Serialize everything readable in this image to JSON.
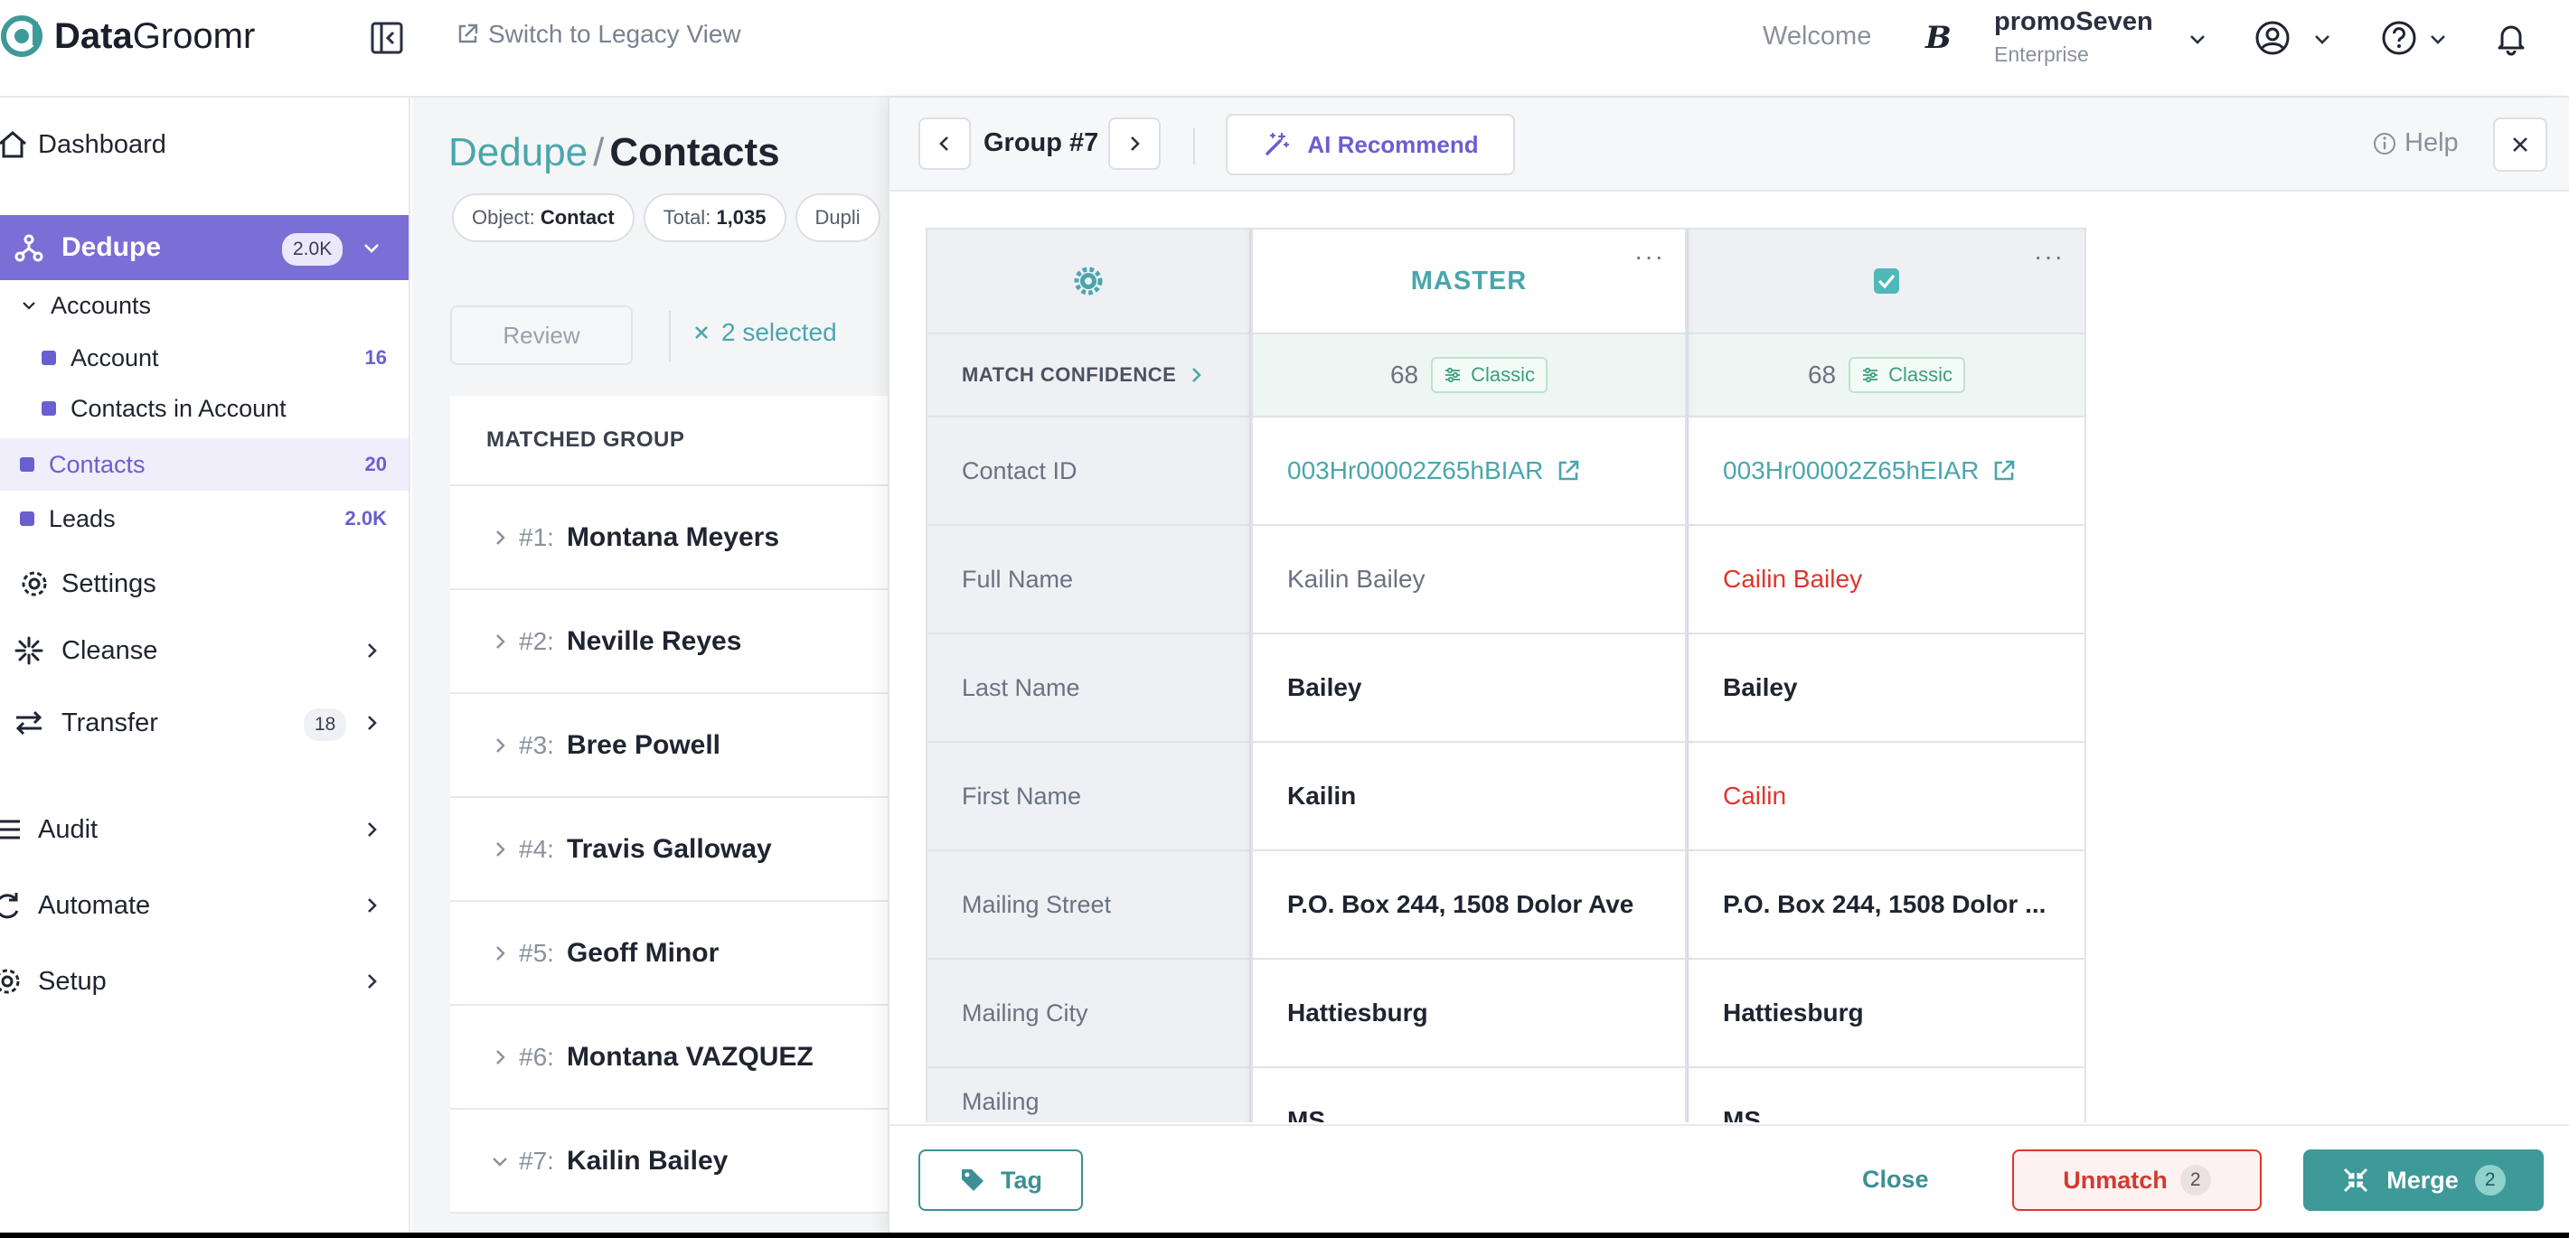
{
  "app": {
    "logo_bold": "Data",
    "logo_rest": "Groomr",
    "accent": "#4aa6ad",
    "brand_purple": "#7b6fd6"
  },
  "topbar": {
    "legacy_label": "Switch to Legacy View",
    "welcome": "Welcome",
    "org_icon": "B",
    "org_name": "promoSeven",
    "org_tier": "Enterprise"
  },
  "sidebar": {
    "dashboard": "Dashboard",
    "dedupe": {
      "label": "Dedupe",
      "badge": "2.0K"
    },
    "accounts": "Accounts",
    "account": {
      "label": "Account",
      "count": "16"
    },
    "contacts_in_account": "Contacts in Account",
    "contacts": {
      "label": "Contacts",
      "count": "20"
    },
    "leads": {
      "label": "Leads",
      "count": "2.0K"
    },
    "settings": "Settings",
    "cleanse": "Cleanse",
    "transfer": {
      "label": "Transfer",
      "badge": "18"
    },
    "audit": "Audit",
    "automate": "Automate",
    "setup": "Setup"
  },
  "main": {
    "crumb_root": "Dedupe",
    "crumb_sep": "/",
    "crumb_current": "Contacts",
    "pill_object_label": "Object:",
    "pill_object_value": "Contact",
    "pill_total_label": "Total:",
    "pill_total_value": "1,035",
    "pill_dup_label": "Dupli",
    "review": "Review",
    "selected": "2 selected",
    "list_header": "MATCHED GROUP",
    "groups": [
      {
        "num": "#1:",
        "name": "Montana Meyers"
      },
      {
        "num": "#2:",
        "name": "Neville Reyes"
      },
      {
        "num": "#3:",
        "name": "Bree Powell"
      },
      {
        "num": "#4:",
        "name": "Travis Galloway"
      },
      {
        "num": "#5:",
        "name": "Geoff Minor"
      },
      {
        "num": "#6:",
        "name": "Montana VAZQUEZ"
      },
      {
        "num": "#7:",
        "name": "Kailin Bailey"
      }
    ]
  },
  "panel": {
    "group_title": "Group #7",
    "ai_recommend": "AI Recommend",
    "help": "Help",
    "master_header": "MASTER",
    "match_confidence": "MATCH CONFIDENCE",
    "classic": "Classic",
    "fields": {
      "contact_id": "Contact ID",
      "full_name": "Full Name",
      "last_name": "Last Name",
      "first_name": "First Name",
      "mailing_street": "Mailing Street",
      "mailing_city": "Mailing City",
      "mailing_state": "Mailing"
    },
    "master": {
      "confidence": "68",
      "contact_id": "003Hr00002Z65hBIAR",
      "full_name": "Kailin Bailey",
      "last_name": "Bailey",
      "first_name": "Kailin",
      "mailing_street": "P.O. Box 244, 1508 Dolor Ave",
      "mailing_city": "Hattiesburg",
      "mailing_state": "MS"
    },
    "duplicate": {
      "confidence": "68",
      "contact_id": "003Hr00002Z65hEIAR",
      "full_name": "Cailin Bailey",
      "last_name": "Bailey",
      "first_name": "Cailin",
      "mailing_street": "P.O. Box 244, 1508 Dolor ...",
      "mailing_city": "Hattiesburg",
      "mailing_state": "MS"
    },
    "footer": {
      "tag": "Tag",
      "close": "Close",
      "unmatch": "Unmatch",
      "unmatch_count": "2",
      "merge": "Merge",
      "merge_count": "2"
    }
  }
}
